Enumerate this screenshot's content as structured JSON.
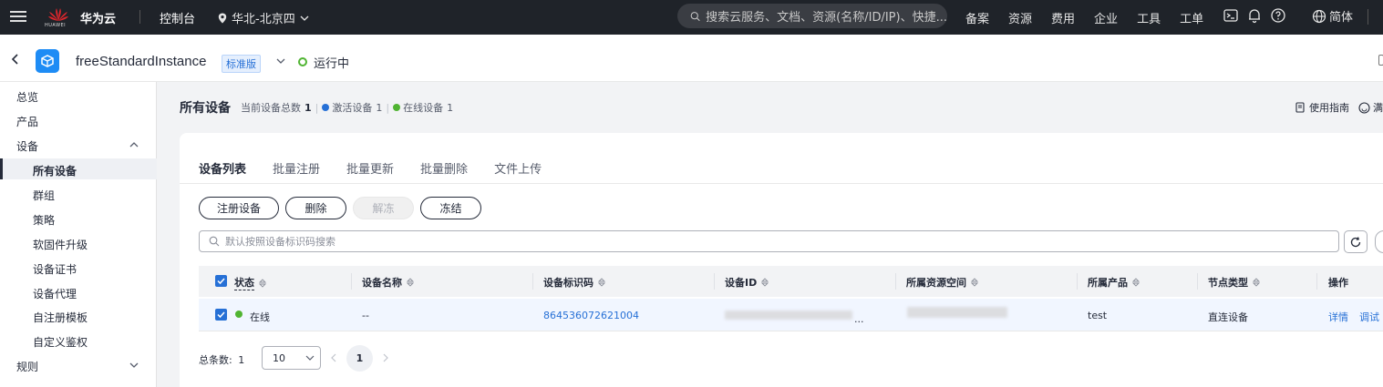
{
  "topbar": {
    "logo_text": "HUAWEI",
    "brand": "华为云",
    "console": "控制台",
    "region": "华北-北京四",
    "search_placeholder": "搜索云服务、文档、资源(名称/ID/IP)、快捷...",
    "nav_links": [
      "备案",
      "资源",
      "费用",
      "企业",
      "工具",
      "工单"
    ],
    "language": "简体"
  },
  "instance": {
    "name": "freeStandardInstance",
    "edition": "标准版",
    "status": "运行中",
    "status_color": "#50b432"
  },
  "sidebar": {
    "items": [
      {
        "label": "总览"
      },
      {
        "label": "产品"
      },
      {
        "label": "设备",
        "expanded": true
      },
      {
        "label": "所有设备",
        "active": true
      },
      {
        "label": "群组"
      },
      {
        "label": "策略"
      },
      {
        "label": "软固件升级"
      },
      {
        "label": "设备证书"
      },
      {
        "label": "设备代理"
      },
      {
        "label": "自注册模板"
      },
      {
        "label": "自定义鉴权"
      },
      {
        "label": "规则",
        "expanded": false
      }
    ]
  },
  "page": {
    "title": "所有设备",
    "stats": {
      "total_label": "当前设备总数",
      "total": "1",
      "activated_label": "激活设备",
      "activated": "1",
      "online_label": "在线设备",
      "online": "1",
      "activated_color": "#2670d6",
      "online_color": "#50b432"
    },
    "guide": "使用指南",
    "guide2": "满"
  },
  "tabs": [
    "设备列表",
    "批量注册",
    "批量更新",
    "批量删除",
    "文件上传"
  ],
  "actions": {
    "register": "注册设备",
    "delete": "删除",
    "unfreeze": "解冻",
    "freeze": "冻结"
  },
  "search": {
    "placeholder": "默认按照设备标识码搜索"
  },
  "table": {
    "headers": [
      "状态",
      "设备名称",
      "设备标识码",
      "设备ID",
      "所属资源空间",
      "所属产品",
      "节点类型",
      "操作"
    ],
    "rows": [
      {
        "status": "在线",
        "name": "--",
        "identifier": "864536072621004",
        "device_id_suffix": "...",
        "product": "test",
        "node_type": "直连设备",
        "actions": [
          "详情",
          "调试"
        ]
      }
    ]
  },
  "pagination": {
    "total_label": "总条数:",
    "total": "1",
    "page_size": "10",
    "current_page": "1"
  }
}
